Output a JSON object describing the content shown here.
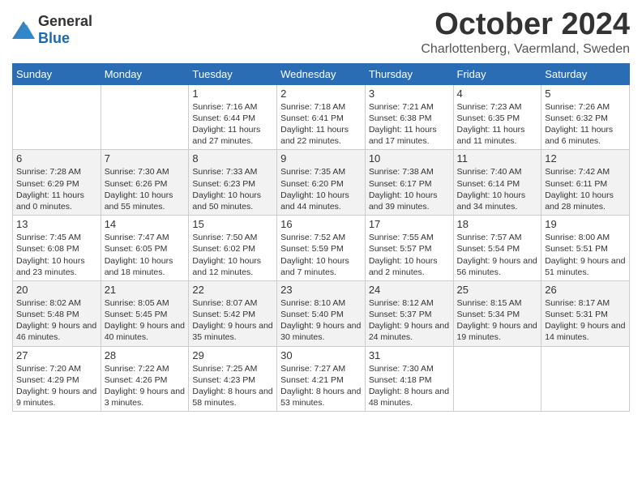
{
  "logo": {
    "general": "General",
    "blue": "Blue"
  },
  "header": {
    "month": "October 2024",
    "location": "Charlottenberg, Vaermland, Sweden"
  },
  "weekdays": [
    "Sunday",
    "Monday",
    "Tuesday",
    "Wednesday",
    "Thursday",
    "Friday",
    "Saturday"
  ],
  "weeks": [
    [
      {
        "day": "",
        "info": ""
      },
      {
        "day": "",
        "info": ""
      },
      {
        "day": "1",
        "info": "Sunrise: 7:16 AM\nSunset: 6:44 PM\nDaylight: 11 hours and 27 minutes."
      },
      {
        "day": "2",
        "info": "Sunrise: 7:18 AM\nSunset: 6:41 PM\nDaylight: 11 hours and 22 minutes."
      },
      {
        "day": "3",
        "info": "Sunrise: 7:21 AM\nSunset: 6:38 PM\nDaylight: 11 hours and 17 minutes."
      },
      {
        "day": "4",
        "info": "Sunrise: 7:23 AM\nSunset: 6:35 PM\nDaylight: 11 hours and 11 minutes."
      },
      {
        "day": "5",
        "info": "Sunrise: 7:26 AM\nSunset: 6:32 PM\nDaylight: 11 hours and 6 minutes."
      }
    ],
    [
      {
        "day": "6",
        "info": "Sunrise: 7:28 AM\nSunset: 6:29 PM\nDaylight: 11 hours and 0 minutes."
      },
      {
        "day": "7",
        "info": "Sunrise: 7:30 AM\nSunset: 6:26 PM\nDaylight: 10 hours and 55 minutes."
      },
      {
        "day": "8",
        "info": "Sunrise: 7:33 AM\nSunset: 6:23 PM\nDaylight: 10 hours and 50 minutes."
      },
      {
        "day": "9",
        "info": "Sunrise: 7:35 AM\nSunset: 6:20 PM\nDaylight: 10 hours and 44 minutes."
      },
      {
        "day": "10",
        "info": "Sunrise: 7:38 AM\nSunset: 6:17 PM\nDaylight: 10 hours and 39 minutes."
      },
      {
        "day": "11",
        "info": "Sunrise: 7:40 AM\nSunset: 6:14 PM\nDaylight: 10 hours and 34 minutes."
      },
      {
        "day": "12",
        "info": "Sunrise: 7:42 AM\nSunset: 6:11 PM\nDaylight: 10 hours and 28 minutes."
      }
    ],
    [
      {
        "day": "13",
        "info": "Sunrise: 7:45 AM\nSunset: 6:08 PM\nDaylight: 10 hours and 23 minutes."
      },
      {
        "day": "14",
        "info": "Sunrise: 7:47 AM\nSunset: 6:05 PM\nDaylight: 10 hours and 18 minutes."
      },
      {
        "day": "15",
        "info": "Sunrise: 7:50 AM\nSunset: 6:02 PM\nDaylight: 10 hours and 12 minutes."
      },
      {
        "day": "16",
        "info": "Sunrise: 7:52 AM\nSunset: 5:59 PM\nDaylight: 10 hours and 7 minutes."
      },
      {
        "day": "17",
        "info": "Sunrise: 7:55 AM\nSunset: 5:57 PM\nDaylight: 10 hours and 2 minutes."
      },
      {
        "day": "18",
        "info": "Sunrise: 7:57 AM\nSunset: 5:54 PM\nDaylight: 9 hours and 56 minutes."
      },
      {
        "day": "19",
        "info": "Sunrise: 8:00 AM\nSunset: 5:51 PM\nDaylight: 9 hours and 51 minutes."
      }
    ],
    [
      {
        "day": "20",
        "info": "Sunrise: 8:02 AM\nSunset: 5:48 PM\nDaylight: 9 hours and 46 minutes."
      },
      {
        "day": "21",
        "info": "Sunrise: 8:05 AM\nSunset: 5:45 PM\nDaylight: 9 hours and 40 minutes."
      },
      {
        "day": "22",
        "info": "Sunrise: 8:07 AM\nSunset: 5:42 PM\nDaylight: 9 hours and 35 minutes."
      },
      {
        "day": "23",
        "info": "Sunrise: 8:10 AM\nSunset: 5:40 PM\nDaylight: 9 hours and 30 minutes."
      },
      {
        "day": "24",
        "info": "Sunrise: 8:12 AM\nSunset: 5:37 PM\nDaylight: 9 hours and 24 minutes."
      },
      {
        "day": "25",
        "info": "Sunrise: 8:15 AM\nSunset: 5:34 PM\nDaylight: 9 hours and 19 minutes."
      },
      {
        "day": "26",
        "info": "Sunrise: 8:17 AM\nSunset: 5:31 PM\nDaylight: 9 hours and 14 minutes."
      }
    ],
    [
      {
        "day": "27",
        "info": "Sunrise: 7:20 AM\nSunset: 4:29 PM\nDaylight: 9 hours and 9 minutes."
      },
      {
        "day": "28",
        "info": "Sunrise: 7:22 AM\nSunset: 4:26 PM\nDaylight: 9 hours and 3 minutes."
      },
      {
        "day": "29",
        "info": "Sunrise: 7:25 AM\nSunset: 4:23 PM\nDaylight: 8 hours and 58 minutes."
      },
      {
        "day": "30",
        "info": "Sunrise: 7:27 AM\nSunset: 4:21 PM\nDaylight: 8 hours and 53 minutes."
      },
      {
        "day": "31",
        "info": "Sunrise: 7:30 AM\nSunset: 4:18 PM\nDaylight: 8 hours and 48 minutes."
      },
      {
        "day": "",
        "info": ""
      },
      {
        "day": "",
        "info": ""
      }
    ]
  ]
}
